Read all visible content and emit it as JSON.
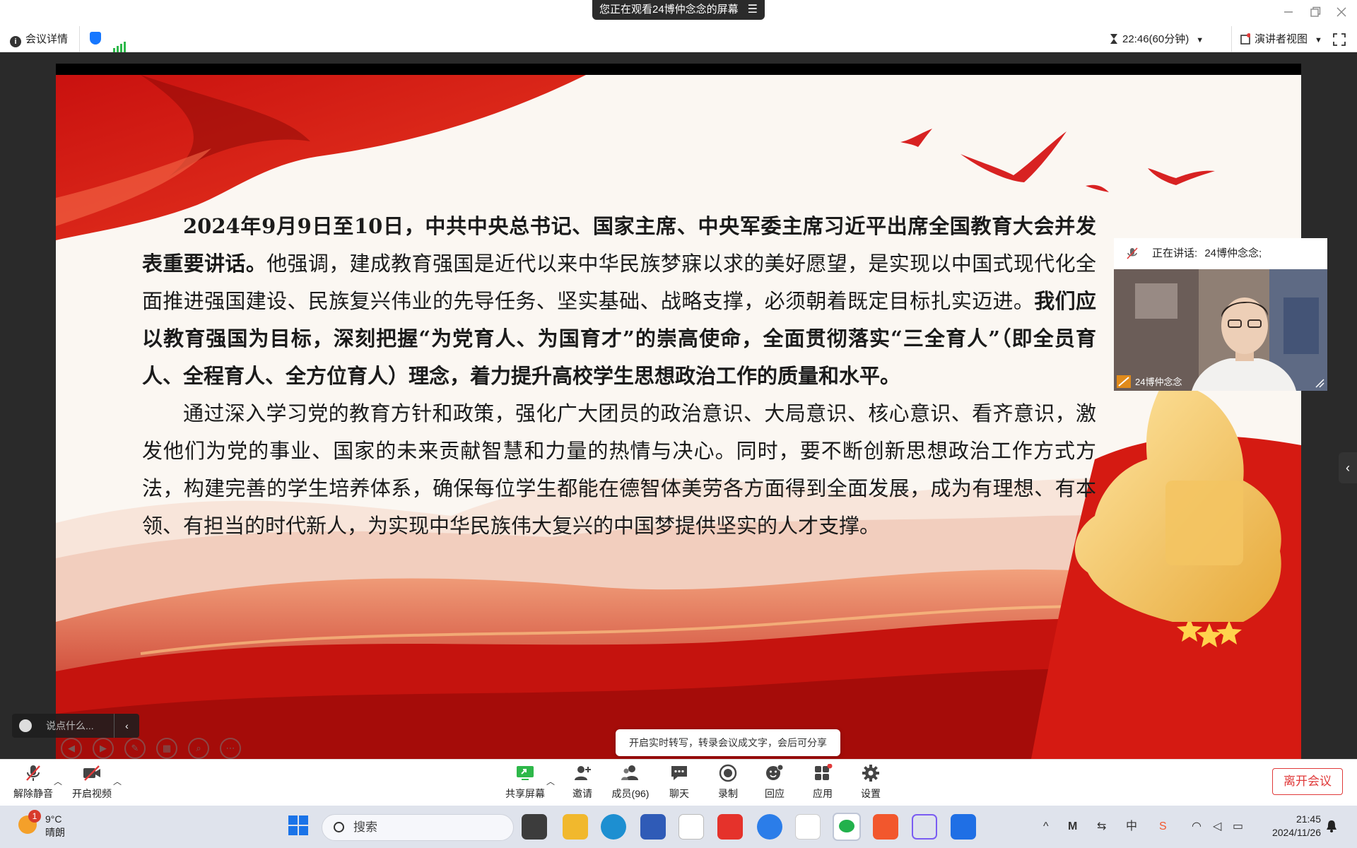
{
  "titlebar": {
    "share_notice": "您正在观看24博仲念念的屏幕",
    "menu_glyph": "☰"
  },
  "infobar": {
    "meeting_details": "会议详情",
    "timer": "22:46(60分钟)",
    "view_mode": "演讲者视图"
  },
  "slide": {
    "para1_lead": "2024年9月9日至10日，中共中央总书记、国家主席、中央军委主席习近平出席全国教育大会并发表重要讲话。",
    "para1_mid": "他强调，建成教育强国是近代以来中华民族梦寐以求的美好愿望，是实现以中国式现代化全面推进强国建设、民族复兴伟业的先导任务、坚实基础、战略支撑，必须朝着既定目标扎实迈进。",
    "para1_tail": "我们应以教育强国为目标，深刻把握“为党育人、为国育才”的崇高使命，全面贯彻落实“三全育人”（即全员育人、全程育人、全方位育人）理念，着力提升高校学生思想政治工作的质量和水平。",
    "para2": "通过深入学习党的教育方针和政策，强化广大团员的政治意识、大局意识、核心意识、看齐意识，激发他们为党的事业、国家的未来贡献智慧和力量的热情与决心。同时，要不断创新思想政治工作方式方法，构建完善的学生培养体系，确保每位学生都能在德智体美劳各方面得到全面发展，成为有理想、有本领、有担当的时代新人，为实现中华民族伟大复兴的中国梦提供坚实的人才支撑。"
  },
  "speaker": {
    "label": "正在讲话:",
    "name_header": "24博仲念念;",
    "name_tag": "24博仲念念"
  },
  "chat": {
    "placeholder": "说点什么..."
  },
  "tip": "开启实时转写，转录会议成文字，会后可分享",
  "toolbar": {
    "unmute": "解除静音",
    "video": "开启视频",
    "share": "共享屏幕",
    "invite": "邀请",
    "members": "成员(96)",
    "chat": "聊天",
    "record": "录制",
    "react": "回应",
    "apps": "应用",
    "settings": "设置",
    "leave": "离开会议"
  },
  "taskbar": {
    "weather_badge": "1",
    "temp": "9°C",
    "condition": "晴朗",
    "search": "搜索",
    "time": "21:45",
    "date": "2024/11/26",
    "ime": "中"
  },
  "colors": {
    "accent_red": "#e03a3a",
    "share_green": "#2eb84a",
    "shield_blue": "#1677ff"
  }
}
